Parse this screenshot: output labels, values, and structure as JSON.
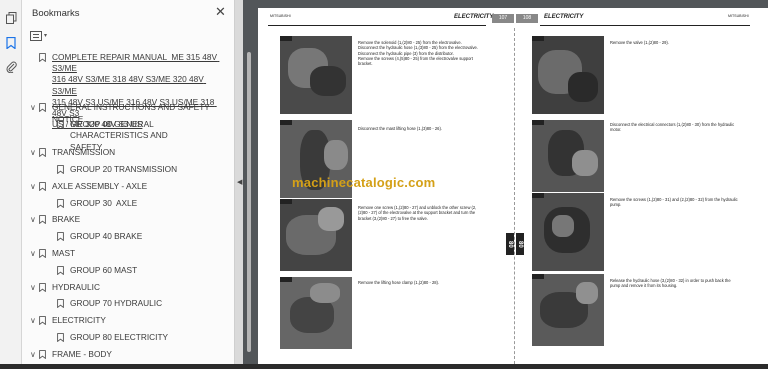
{
  "panel": {
    "title": "Bookmarks",
    "close_glyph": "✕",
    "icons": [
      "pages-icon",
      "bookmark-icon",
      "attachment-icon"
    ]
  },
  "bookmarks": [
    {
      "level": 0,
      "chev": "",
      "label": "COMPLETE REPAIR MANUAL  ME 315 48V S3/ME\n316 48V S3/ME 318 48V S3/ME 320 48V S3/ME\n315 48V S3 US/ME 316 48V S3 US/ME 318 48V S3\nUS / ME 320 48V S3 US",
      "link": true
    },
    {
      "level": 0,
      "chev": "∨",
      "label": "GENERAL INSTRUCTIONS AND SAFETY NOTICE"
    },
    {
      "level": 1,
      "chev": "",
      "label": "GROUP 00 GENERAL CHARACTERISTICS AND\nSAFETY"
    },
    {
      "level": 0,
      "chev": "∨",
      "label": "TRANSMISSION"
    },
    {
      "level": 1,
      "chev": "",
      "label": "GROUP 20 TRANSMISSION"
    },
    {
      "level": 0,
      "chev": "∨",
      "label": "AXLE ASSEMBLY - AXLE"
    },
    {
      "level": 1,
      "chev": "",
      "label": "GROUP 30  AXLE"
    },
    {
      "level": 0,
      "chev": "∨",
      "label": "BRAKE"
    },
    {
      "level": 1,
      "chev": "",
      "label": "GROUP 40 BRAKE"
    },
    {
      "level": 0,
      "chev": "∨",
      "label": "MAST"
    },
    {
      "level": 1,
      "chev": "",
      "label": "GROUP 60 MAST"
    },
    {
      "level": 0,
      "chev": "∨",
      "label": "HYDRAULIC"
    },
    {
      "level": 1,
      "chev": "",
      "label": "GROUP 70 HYDRAULIC"
    },
    {
      "level": 0,
      "chev": "∨",
      "label": "ELECTRICITY"
    },
    {
      "level": 1,
      "chev": "",
      "label": "GROUP 80 ELECTRICITY"
    },
    {
      "level": 0,
      "chev": "∨",
      "label": "FRAME - BODY"
    },
    {
      "level": 1,
      "chev": "",
      "label": "GROUP 90 FRAME-BODY"
    }
  ],
  "document": {
    "left": {
      "brand": "MITSUBISHI",
      "section": "ELECTRICITY",
      "page": "107"
    },
    "right": {
      "brand": "MITSUBISHI",
      "section": "ELECTRICITY",
      "page": "108"
    },
    "side_mark": "80",
    "watermark": "machinecatalogic.com",
    "captions_left": [
      "Remove the solenoid (1,(2)80 - 25) from the electrovalve.\nDisconnect the hydraulic hose (1,(3)80 - 25) from the electrovalve.\nDisconnect the hydraulic pipe (3) from the distributor.\nRemove the screws (4,(5)80 - 25) from the electrovalve support\nbracket.",
      "Disconnect the mast lifting hose (1,(3)80 - 26).",
      "Remove one screw (1,(2)80 - 27) and unblock the other screw (2,\n(2)80 - 27) of the electrovalve at the support bracket and turn the\nbracket (3,(2)80 - 27) to free the valve.",
      "Remove the lifting hose clamp (1,(2)80 - 28)."
    ],
    "captions_right": [
      "Remove the valve (1,(2)80 - 29).",
      "Disconnect the electrical connectors (1,(2)80 - 30) from the hydraulic\nmotor.",
      "Remove the screws (1,(2)80 - 31) and (2,(2)80 - 32) from the hydraulic\npump.",
      "Release the hydraulic hose (3,(2)80 - 32) in order to push back the\npump and remove it from its housing."
    ]
  }
}
